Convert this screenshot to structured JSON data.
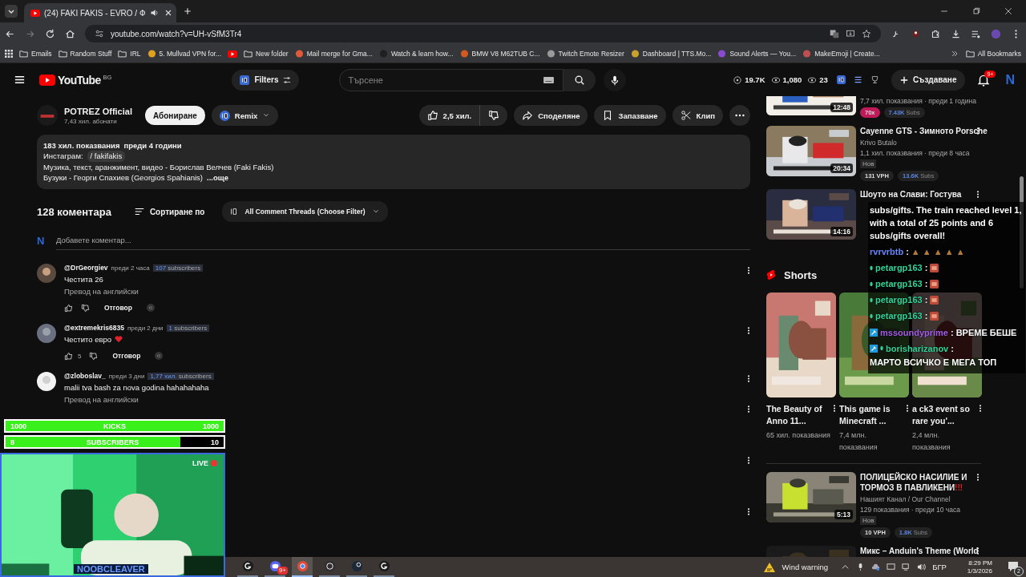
{
  "browser": {
    "tab_title": "(24) FAKI FAKIS - EVRO / Ф",
    "url": "youtube.com/watch?v=UH-vSfM3Tr4",
    "bookmarks": [
      {
        "kind": "apps"
      },
      {
        "kind": "folder",
        "label": "Emails"
      },
      {
        "kind": "folder",
        "label": "Random Stuff"
      },
      {
        "kind": "folder",
        "label": "IRL"
      },
      {
        "kind": "site",
        "label": "5. Mullvad VPN for...",
        "color": "#e0a020"
      },
      {
        "kind": "youtube"
      },
      {
        "kind": "folder",
        "label": "New folder"
      },
      {
        "kind": "site",
        "label": "Mail merge for Gma...",
        "color": "#e05a3a"
      },
      {
        "kind": "site",
        "label": "Watch & learn how...",
        "color": "#202020"
      },
      {
        "kind": "site",
        "label": "BMW V8 M62TUB C...",
        "color": "#d05a20"
      },
      {
        "kind": "site",
        "label": "Twitch Emote Resizer",
        "color": "#9a9a9a"
      },
      {
        "kind": "site",
        "label": "Dashboard | TTS.Mo...",
        "color": "#c8a030"
      },
      {
        "kind": "site",
        "label": "Sound Alerts — You...",
        "color": "#8a4ad0"
      },
      {
        "kind": "site",
        "label": "MakeEmoji | Create...",
        "color": "#c05050"
      }
    ],
    "all_bookmarks": "All Bookmarks"
  },
  "header": {
    "logo": "YouTube",
    "region": "BG",
    "filters": "Filters",
    "search_placeholder": "Търсене",
    "stats": [
      {
        "kind": "subs",
        "value": "19.7K"
      },
      {
        "kind": "views",
        "value": "1,080"
      },
      {
        "kind": "viewers",
        "value": "23"
      }
    ],
    "create": "Създаване",
    "notifications": "9+",
    "avatar": "N"
  },
  "video": {
    "channel": "POTREZ Official",
    "subscribers": "7,43 хил. абонати",
    "subscribe": "Абониране",
    "remix": "Remix",
    "likes": "2,5 хил.",
    "share": "Споделяне",
    "save": "Запазване",
    "clip": "Клип",
    "description": {
      "views": "183 хил. показвания",
      "age": "преди 4 години",
      "instagram_label": "Инстаграм:",
      "instagram_handle": "/ fakifakis",
      "lines": [
        "Музика, текст, аранжимент, видео - Борислав Велчев (Faki Fakis)",
        "Бузуки - Георги Спахиев (Georgios Spahianis)"
      ],
      "more": "...още"
    }
  },
  "comments": {
    "count": "128 коментара",
    "sort": "Сортиране по",
    "filter": "All Comment Threads (Choose Filter)",
    "user_avatar": "N",
    "add_placeholder": "Добавете коментар...",
    "items": [
      {
        "author": "@DrGeorgiev",
        "time": "преди 2 часа",
        "subs_value": "107",
        "subs_label": "subscribers",
        "text": "Честита 26",
        "heart": false,
        "translate": "Превод на английски",
        "reply": "Отговор"
      },
      {
        "author": "@extremekris6835",
        "time": "преди 2 дни",
        "subs_value": "1",
        "subs_label": "subscribers",
        "text": "Честито евро",
        "heart": true,
        "likes": "5",
        "reply": "Отговор"
      },
      {
        "author": "@zloboslav_",
        "time": "преди 3 дни",
        "subs_value": "1,77 хил.",
        "subs_label": "subscribers",
        "text": "malii tva bash za nova godina hahahahaha",
        "heart": false,
        "translate": "Превод на английски"
      }
    ]
  },
  "sidebar": {
    "videos_top": [
      {
        "duration": "12:48",
        "meta": "7,7 хил. показвания · преди 1 година",
        "badges": [
          {
            "kind": "multiplier",
            "text": "70x"
          },
          {
            "kind": "subs",
            "value": "7.43K",
            "label": "Subs"
          }
        ]
      },
      {
        "title": "Cayenne GTS - Зимното Porsche",
        "channel": "Krivo Butalo",
        "duration": "20:34",
        "meta": "1,1 хил. показвания · преди 8 часа",
        "new": "Нов",
        "badges": [
          {
            "kind": "vph",
            "text": "131 VPH"
          },
          {
            "kind": "subs",
            "value": "13.6K",
            "label": "Subs"
          }
        ]
      },
      {
        "title": "Шоуто на Слави: Гостува",
        "duration": "14:16"
      }
    ],
    "shorts_label": "Shorts",
    "shorts": [
      {
        "title": "The Beauty of Anno 11...",
        "views": "65 хил. показвания"
      },
      {
        "title": "This game is Minecraft ...",
        "views": "7,4 млн. показвания"
      },
      {
        "title": "a ck3 event so rare you'...",
        "views": "2,4 млн. показвания"
      }
    ],
    "videos_bottom": [
      {
        "title": "ПОЛИЦЕЙСКО НАСИЛИЕ И ТОРМОЗ В ПАВЛИКЕНИ",
        "title_mark": "!!!",
        "channel": "Нашият Канал / Our Channel",
        "duration": "5:13",
        "meta": "129 показвания · преди 10 часа",
        "new": "Нов",
        "badges": [
          {
            "kind": "vph",
            "text": "10 VPH"
          },
          {
            "kind": "subs",
            "value": "1.8K",
            "label": "Subs"
          }
        ]
      },
      {
        "title": "Микс – Anduin's Theme (World"
      }
    ]
  },
  "chat": [
    {
      "kind": "system",
      "text": "subs/gifts. The train reached level 1, with a total of 25 points and 6 subs/gifts overall!"
    },
    {
      "kind": "message",
      "user": "rvrvrbtb",
      "color": "#6a86ff",
      "moderator": false,
      "dot": false,
      "separator": ":",
      "text": "▲ ▲ ▲ ▲ ▲"
    },
    {
      "kind": "emote",
      "user": "petargp163",
      "color": "#2fd39a",
      "moderator": false,
      "dot": true,
      "separator": ":"
    },
    {
      "kind": "emote",
      "user": "petargp163",
      "color": "#2fd39a",
      "moderator": false,
      "dot": true,
      "separator": ":"
    },
    {
      "kind": "emote",
      "user": "petargp163",
      "color": "#2fd39a",
      "moderator": false,
      "dot": true,
      "separator": ":"
    },
    {
      "kind": "emote",
      "user": "petargp163",
      "color": "#2fd39a",
      "moderator": false,
      "dot": true,
      "separator": ":"
    },
    {
      "kind": "message",
      "user": "mssoundyprime",
      "color": "#a35be8",
      "moderator": true,
      "dot": false,
      "separator": ":",
      "text": "ВРЕМЕ БЕШЕ"
    },
    {
      "kind": "message",
      "user": "borisharizanov",
      "color": "#2fd39a",
      "moderator": true,
      "dot": true,
      "separator": ":",
      "text": "МАРТО ВСИЧКО Е МЕГА ТОП"
    }
  ],
  "stream": {
    "bars": [
      {
        "start": "1000",
        "label": "KICKS",
        "goal": "1000",
        "level": 1
      },
      {
        "start": "8",
        "label": "SUBSCRIBERS",
        "goal": "10",
        "level": 0.8
      }
    ],
    "live": "LIVE",
    "name": "NOOBCLEAVER"
  },
  "taskbar": {
    "apps": [
      {
        "kind": "logitech",
        "selected": false
      },
      {
        "kind": "discord",
        "badge": "9+",
        "selected": false
      },
      {
        "kind": "chrome",
        "selected": true
      },
      {
        "kind": "obs",
        "selected": false
      },
      {
        "kind": "steam",
        "selected": false
      },
      {
        "kind": "logitech",
        "selected": false
      }
    ],
    "weather": "Wind warning",
    "language": "БГР",
    "time": "8:29 PM",
    "date": "1/3/2026",
    "notifications": "2"
  }
}
